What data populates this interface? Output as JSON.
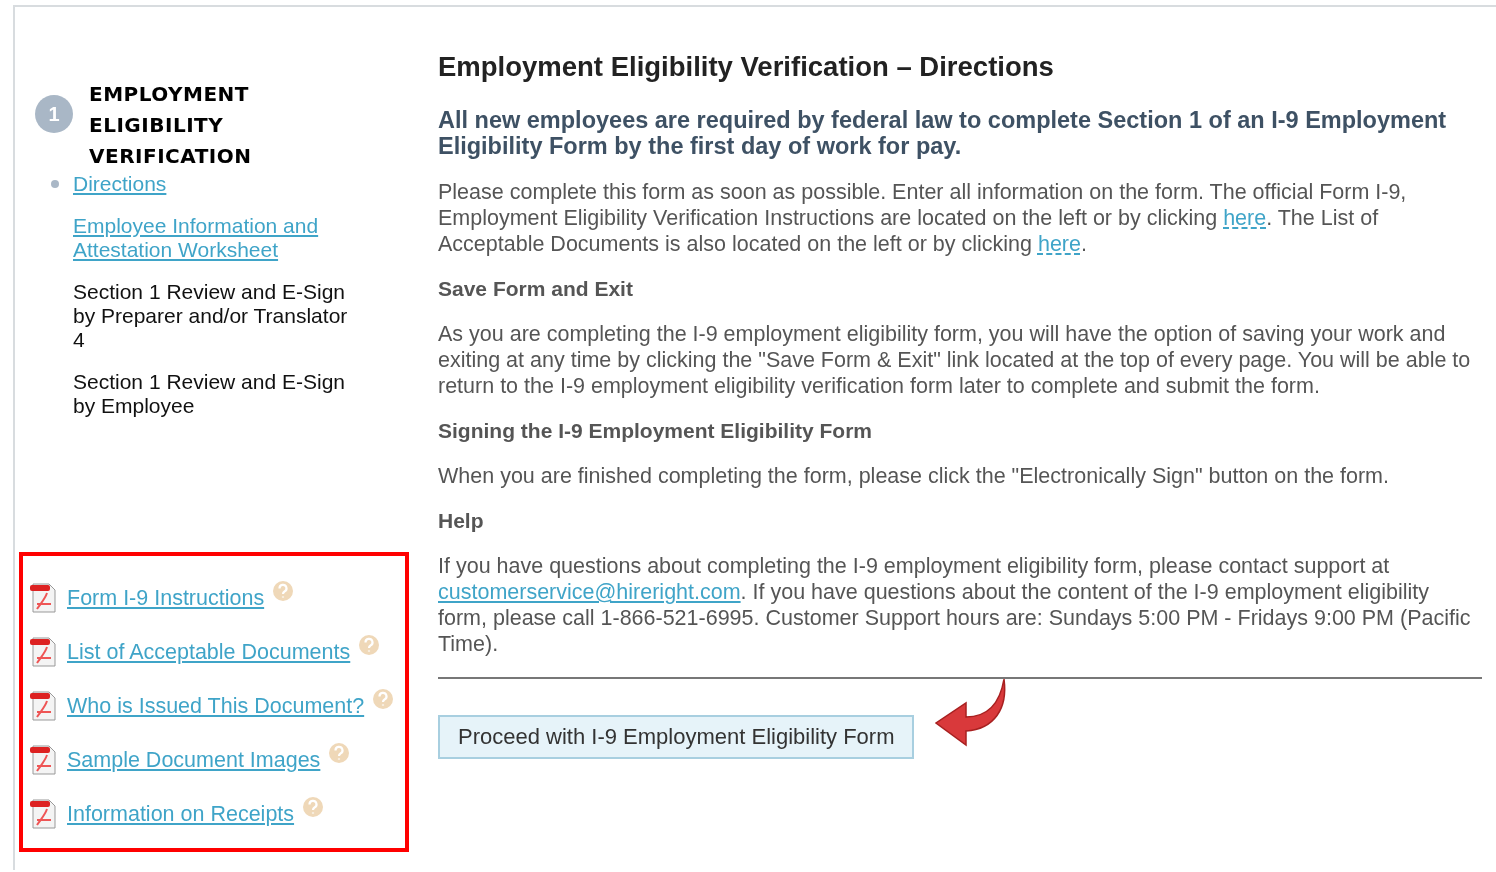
{
  "step": {
    "number": "1",
    "title": "EMPLOYMENT ELIGIBILITY VERIFICATION"
  },
  "steps": [
    {
      "label": "Directions",
      "kind": "link",
      "selected": true
    },
    {
      "label": "Employee Information and Attestation Worksheet",
      "kind": "link",
      "selected": false
    },
    {
      "label": "Section 1 Review and E-Sign by Preparer and/or Translator",
      "note": "4",
      "kind": "text",
      "selected": false
    },
    {
      "label": "Section 1 Review and E-Sign by Employee",
      "kind": "text",
      "selected": false
    }
  ],
  "documents": [
    {
      "label": "Form I-9 Instructions"
    },
    {
      "label": "List of Acceptable Documents"
    },
    {
      "label": "Who is Issued This Document?"
    },
    {
      "label": "Sample Document Images"
    },
    {
      "label": "Information on Receipts"
    }
  ],
  "main": {
    "title": "Employment Eligibility Verification – Directions",
    "intro": "All new employees are required by federal law to complete Section 1 of an I-9 Employment Eligibility Form by the first day of work for pay.",
    "sections": [
      {
        "kind": "paragraph",
        "parts": [
          {
            "text": "Please complete this form as soon as possible. Enter all information on the form. The official Form I-9, Employment Eligibility Verification Instructions are located on the left or by clicking "
          },
          {
            "kind": "here_link",
            "link": "here"
          },
          {
            "text": ". The List of Acceptable Documents is also located on the left or by clicking "
          },
          {
            "kind": "here_link",
            "link": "here"
          },
          {
            "text": "."
          }
        ]
      },
      {
        "kind": "heading",
        "text": "Save Form and Exit"
      },
      {
        "kind": "paragraph",
        "parts": [
          {
            "text": "As you are completing the I-9 employment eligibility form, you will have the option of saving your work and exiting at any time by clicking the \"Save Form & Exit\" link located at the top of every page. You will be able to return to the I-9 employment eligibility verification form later to complete and submit the form."
          }
        ]
      },
      {
        "kind": "heading",
        "text": "Signing the I-9 Employment Eligibility Form"
      },
      {
        "kind": "paragraph",
        "parts": [
          {
            "text": "When you are finished completing the form, please click the \"Electronically Sign\" button on the form."
          }
        ]
      },
      {
        "kind": "heading",
        "text": "Help"
      },
      {
        "kind": "paragraph",
        "parts": [
          {
            "text": "If you have questions about completing the I-9 employment eligibility form, please contact support at "
          },
          {
            "kind": "email_link",
            "link": "customerservice@hireright.com"
          },
          {
            "text": ". If you have questions about the content of the I-9 employment eligibility form, please call 1-866-521-6995. Customer Support hours are: Sundays 5:00 PM - Fridays 9:00 PM (Pacific Time)."
          }
        ]
      }
    ],
    "button": "Proceed with I-9 Employment Eligibility Form"
  }
}
